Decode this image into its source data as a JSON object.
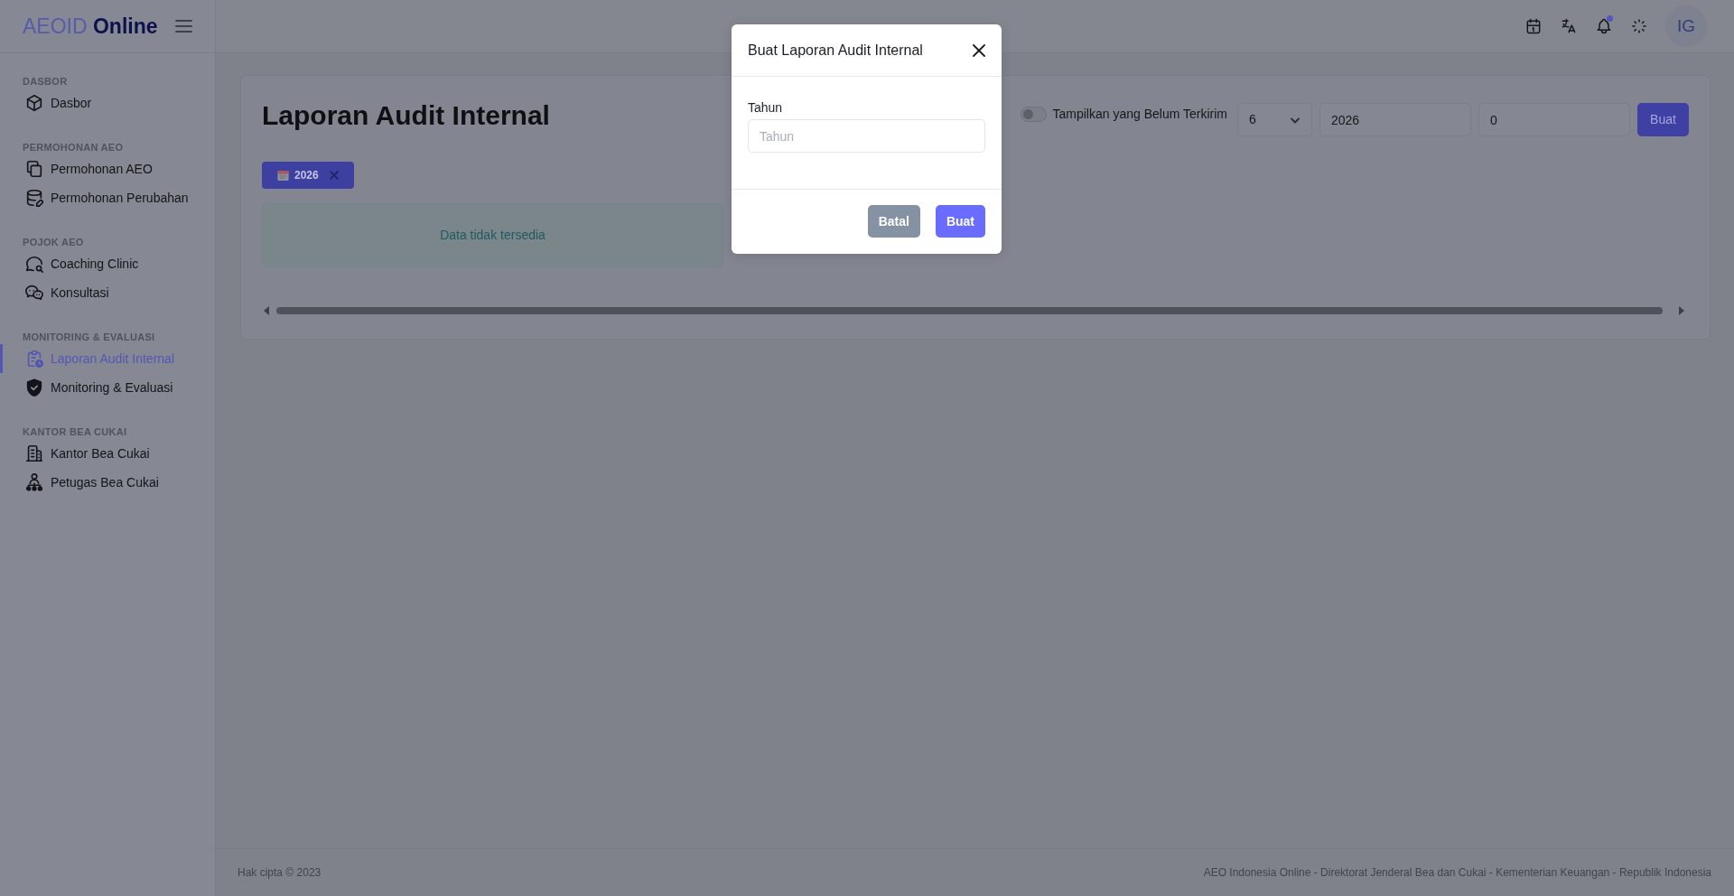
{
  "brand": "AEOID **Online**",
  "sidebar": [
    {
      "section": "DASBOR",
      "items": [
        {
          "label": "Dasbor",
          "selected": false
        }
      ]
    },
    {
      "section": "PERMOHONAN AEO",
      "items": [
        {
          "label": "Permohonan AEO",
          "selected": false
        },
        {
          "label": "Permohonan Perubahan",
          "selected": false
        }
      ]
    },
    {
      "section": "POJOK AEO",
      "items": [
        {
          "label": "Coaching Clinic",
          "selected": false
        },
        {
          "label": "Konsultasi",
          "selected": false
        }
      ]
    },
    {
      "section": "MONITORING & EVALUASI",
      "items": [
        {
          "label": "Laporan Audit Internal",
          "selected": true
        },
        {
          "label": "Monitoring & Evaluasi",
          "selected": false
        }
      ]
    },
    {
      "section": "KANTOR BEA CUKAI",
      "items": [
        {
          "label": "Kantor Bea Cukai",
          "selected": false
        },
        {
          "label": "Petugas Bea Cukai",
          "selected": false
        }
      ]
    }
  ],
  "header": {
    "notification_unread": true,
    "avatar": "IG"
  },
  "page": {
    "title": "Laporan Audit Internal",
    "toggle": {
      "label": "Tampilkan yang Belum Terkirim",
      "on": false
    },
    "select": {
      "value": "6"
    },
    "inputs": [
      {
        "value": "2026"
      },
      {
        "value": "0"
      }
    ],
    "button": "Buat",
    "chips": [
      {
        "label": "2026"
      }
    ],
    "empty_message": "Data tidak tersedia"
  },
  "modal": {
    "title": "Buat Laporan Audit Internal",
    "field": {
      "label": "Tahun",
      "placeholder": "Tahun"
    },
    "buttons": [
      {
        "label": "Batal",
        "kind": "secondary"
      },
      {
        "label": "Buat",
        "kind": "primary"
      }
    ]
  },
  "footer": {
    "left": "Hak cipta © 2023",
    "right": "AEO Indonesia Online - Direktorat Jenderal Bea dan Cukai - Kementerian Keuangan - Republik Indonesia"
  }
}
